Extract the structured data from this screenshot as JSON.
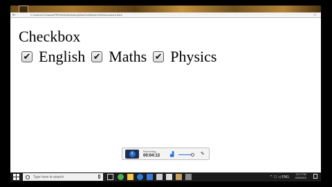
{
  "browser": {
    "back_glyph": "←",
    "address": "C:/Users/CJ/Users/PRIYANKA/Desktop/New%20folder%20/document.html",
    "star_glyph": "☆"
  },
  "page": {
    "heading": "Checkbox",
    "checkboxes": [
      {
        "label": "English",
        "checked": true
      },
      {
        "label": "Maths",
        "checked": true
      },
      {
        "label": "Physics",
        "checked": true
      }
    ],
    "check_glyph": "✔"
  },
  "recorder": {
    "status_label": "Recording...",
    "time": "00:04:13",
    "pause_glyph": "II",
    "chart_glyph": "▟",
    "pen_glyph": "✎"
  },
  "taskbar": {
    "search_placeholder": "Type here to search",
    "tray_icons": "^ ☐ ◁ ENG",
    "time": "12:17 PM",
    "date": "6/25/2018",
    "icon_colors": {
      "task_view": "#dddddd",
      "chrome": "#4caf50",
      "explorer": "#f2c94c",
      "edge": "#2a7fd6",
      "store": "#3a7bd5",
      "mail": "#cfcfcf",
      "app7": "#e0e0e0",
      "app8": "#c8a060",
      "app9": "#888888"
    }
  }
}
